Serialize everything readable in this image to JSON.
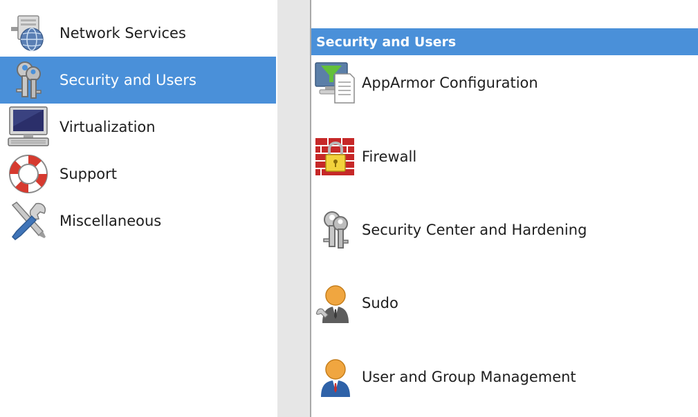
{
  "categories": [
    {
      "label": "Network Services",
      "icon": "network-globe-icon"
    },
    {
      "label": "Security and Users",
      "icon": "keys-icon",
      "selected": true
    },
    {
      "label": "Virtualization",
      "icon": "computer-monitor-icon"
    },
    {
      "label": "Support",
      "icon": "lifebuoy-icon"
    },
    {
      "label": "Miscellaneous",
      "icon": "tools-icon"
    }
  ],
  "group": {
    "title": "Security and Users"
  },
  "modules": [
    {
      "label": "AppArmor Configuration",
      "icon": "apparmor-icon"
    },
    {
      "label": "Firewall",
      "icon": "firewall-lock-icon"
    },
    {
      "label": "Security Center and Hardening",
      "icon": "keys-icon"
    },
    {
      "label": "Sudo",
      "icon": "sudo-user-icon"
    },
    {
      "label": "User and Group Management",
      "icon": "user-icon"
    }
  ],
  "colors": {
    "selection": "#4a90d9",
    "splitter": "#e6e6e6"
  }
}
